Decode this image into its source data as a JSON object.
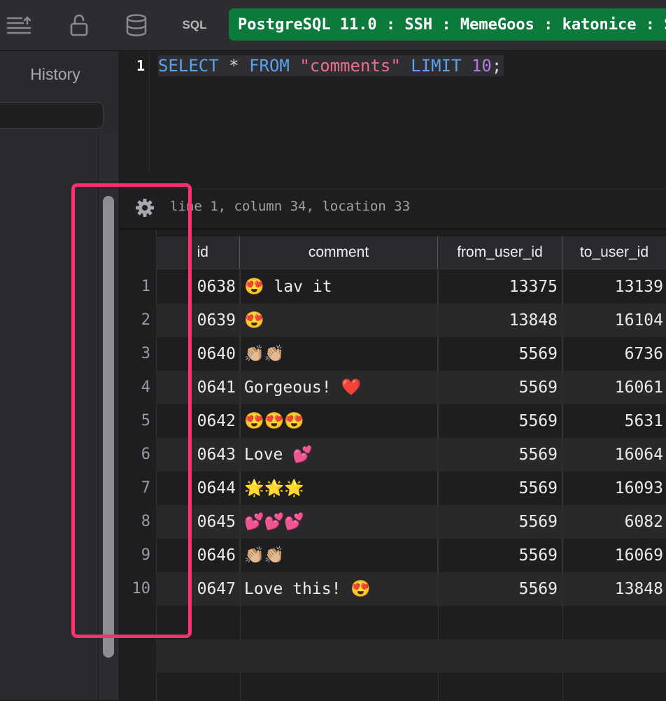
{
  "toolbar": {
    "sql_label": "SQL",
    "connection": "PostgreSQL 11.0 : SSH : MemeGoos : katonice : S"
  },
  "sidebar": {
    "history_label": "History"
  },
  "editor": {
    "line_number": "1",
    "query": {
      "kw_select": "SELECT",
      "star": "*",
      "kw_from": "FROM",
      "table": "\"comments\"",
      "kw_limit": "LIMIT",
      "limit": "10",
      "semicolon": ";"
    },
    "status": "line 1, column 34, location 33"
  },
  "results": {
    "columns": [
      "id",
      "comment",
      "from_user_id",
      "to_user_id"
    ],
    "rows": [
      {
        "n": "1",
        "id": "0638",
        "comment": "😍 lav it",
        "from": "13375",
        "to": "13139"
      },
      {
        "n": "2",
        "id": "0639",
        "comment": "😍",
        "from": "13848",
        "to": "16104"
      },
      {
        "n": "3",
        "id": "0640",
        "comment": "👏🏼👏🏼",
        "from": "5569",
        "to": "6736"
      },
      {
        "n": "4",
        "id": "0641",
        "comment": "Gorgeous! ❤️",
        "from": "5569",
        "to": "16061"
      },
      {
        "n": "5",
        "id": "0642",
        "comment": "😍😍😍",
        "from": "5569",
        "to": "5631"
      },
      {
        "n": "6",
        "id": "0643",
        "comment": "Love 💕",
        "from": "5569",
        "to": "16064"
      },
      {
        "n": "7",
        "id": "0644",
        "comment": "🌟🌟🌟",
        "from": "5569",
        "to": "16093"
      },
      {
        "n": "8",
        "id": "0645",
        "comment": "💕💕💕",
        "from": "5569",
        "to": "6082"
      },
      {
        "n": "9",
        "id": "0646",
        "comment": "👏🏼👏🏼",
        "from": "5569",
        "to": "16069"
      },
      {
        "n": "10",
        "id": "0647",
        "comment": "Love this! 😍",
        "from": "5569",
        "to": "13848"
      }
    ]
  },
  "colors": {
    "connection_bg": "#0b7a3a",
    "highlight": "#ff2f6d",
    "keyword": "#5aa3ee",
    "string": "#ef6d8d",
    "number": "#b37ae0"
  }
}
